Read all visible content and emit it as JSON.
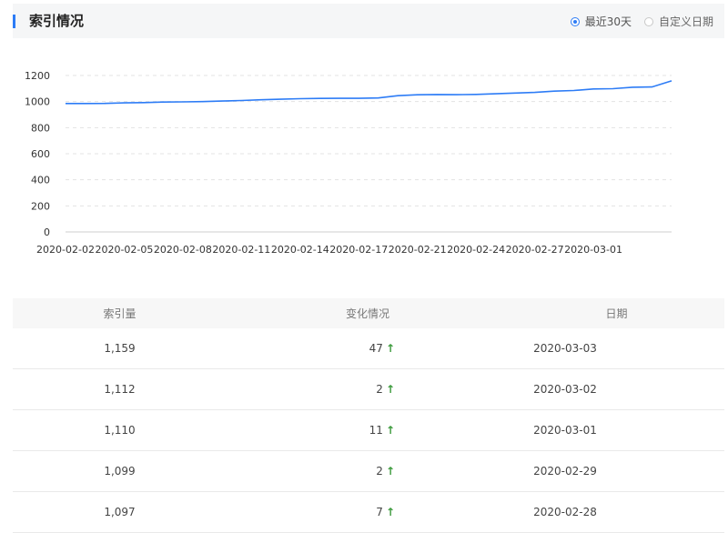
{
  "header": {
    "title": "索引情况",
    "range_options": [
      {
        "label": "最近30天",
        "checked": true
      },
      {
        "label": "自定义日期",
        "checked": false
      }
    ]
  },
  "colors": {
    "accent": "#2d7cf6",
    "up_arrow": "#3b9a3b"
  },
  "chart_data": {
    "type": "line",
    "title": "",
    "xlabel": "",
    "ylabel": "",
    "ylim": [
      0,
      1200
    ],
    "yticks": [
      "0",
      "200",
      "400",
      "600",
      "800",
      "1000",
      "1200"
    ],
    "xticks": [
      "2020-02-02",
      "2020-02-05",
      "2020-02-08",
      "2020-02-11",
      "2020-02-14",
      "2020-02-17",
      "2020-02-21",
      "2020-02-24",
      "2020-02-27",
      "2020-03-01"
    ],
    "grid": true,
    "series": [
      {
        "values": [
          985,
          985,
          986,
          990,
          992,
          996,
          998,
          1000,
          1004,
          1008,
          1014,
          1018,
          1022,
          1024,
          1025,
          1025,
          1028,
          1045,
          1052,
          1054,
          1053,
          1055,
          1060,
          1065,
          1070,
          1080,
          1085,
          1097,
          1099,
          1110,
          1112,
          1159
        ]
      }
    ]
  },
  "table": {
    "headers": [
      "索引量",
      "变化情况",
      "日期"
    ],
    "rows": [
      {
        "index": "1,159",
        "change": "47",
        "date": "2020-03-03"
      },
      {
        "index": "1,112",
        "change": "2",
        "date": "2020-03-02"
      },
      {
        "index": "1,110",
        "change": "11",
        "date": "2020-03-01"
      },
      {
        "index": "1,099",
        "change": "2",
        "date": "2020-02-29"
      },
      {
        "index": "1,097",
        "change": "7",
        "date": "2020-02-28"
      }
    ]
  },
  "icons": {
    "change_up": "arrow-up-icon"
  }
}
